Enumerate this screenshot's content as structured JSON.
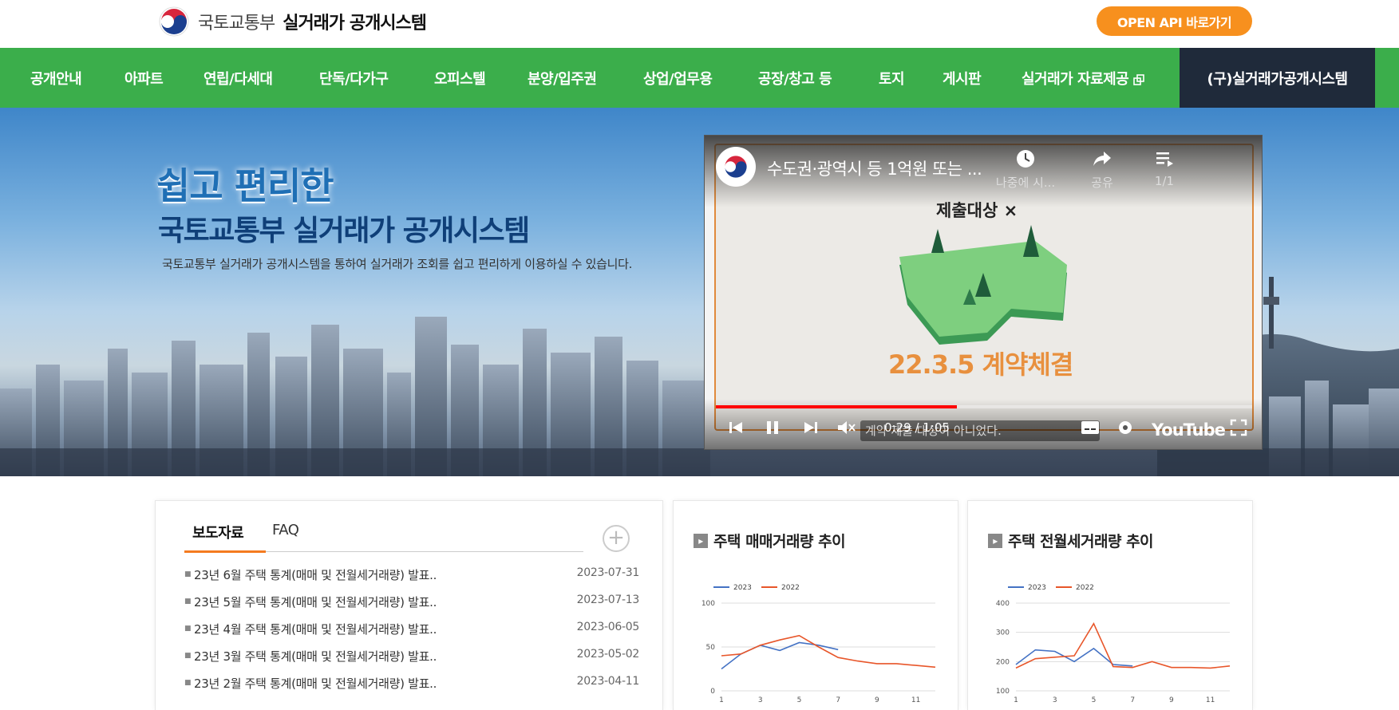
{
  "header": {
    "ministry": "국토교통부",
    "system_name": "실거래가 공개시스템",
    "open_api_label": "OPEN API 바로가기"
  },
  "nav": {
    "items": [
      {
        "label": "공개안내"
      },
      {
        "label": "아파트"
      },
      {
        "label": "연립/다세대"
      },
      {
        "label": "단독/다가구"
      },
      {
        "label": "오피스텔"
      },
      {
        "label": "분양/입주권"
      },
      {
        "label": "상업/업무용"
      },
      {
        "label": "공장/창고 등"
      },
      {
        "label": "토지"
      },
      {
        "label": "게시판"
      },
      {
        "label": "실거래가 자료제공"
      }
    ],
    "old_system_label": "(구)실거래가공개시스템"
  },
  "hero": {
    "title_line1": "쉽고 편리한",
    "title_line2": "국토교통부 실거래가 공개시스템",
    "description": "국토교통부 실거래가 공개시스템을 통하여 실거래가 조회를 쉽고 편리하게 이용하실 수 있습니다."
  },
  "video": {
    "channel_label": "국토교통부",
    "title": "수도권·광역시 등 1억원 또는 ...",
    "watch_later_label": "나중에 시...",
    "share_label": "공유",
    "playlist_label": "1/1",
    "caption_text": "제출대상 ×",
    "date_text": "22.3.5 계약체결",
    "time_display": "0:29 / 1:05",
    "subtitle_text": "계약 제출 대상이 아니었다.",
    "progress_fraction": 0.45,
    "youtube_label": "YouTube"
  },
  "news": {
    "tabs": [
      {
        "label": "보도자료"
      },
      {
        "label": "FAQ"
      }
    ],
    "more_label": "+",
    "items": [
      {
        "title": "23년 6월 주택 통계(매매 및 전월세거래량) 발표..",
        "date": "2023-07-31"
      },
      {
        "title": "23년 5월 주택 통계(매매 및 전월세거래량) 발표..",
        "date": "2023-07-13"
      },
      {
        "title": "23년 4월 주택 통계(매매 및 전월세거래량) 발표..",
        "date": "2023-06-05"
      },
      {
        "title": "23년 3월 주택 통계(매매 및 전월세거래량) 발표..",
        "date": "2023-05-02"
      },
      {
        "title": "23년 2월 주택 통계(매매 및 전월세거래량) 발표..",
        "date": "2023-04-11"
      }
    ]
  },
  "chart_data": [
    {
      "type": "line",
      "title": "주택 매매거래량 추이",
      "legend": "top-left",
      "grid": true,
      "x": [
        1,
        2,
        3,
        4,
        5,
        6,
        7,
        8,
        9,
        10,
        11,
        12
      ],
      "x_ticks": [
        "1",
        "3",
        "5",
        "7",
        "9",
        "11"
      ],
      "y_ticks": [
        "0",
        "50",
        "100"
      ],
      "ylim": [
        0,
        100
      ],
      "series": [
        {
          "name": "2023",
          "color": "#4472c4",
          "values": [
            25,
            42,
            52,
            46,
            55,
            52,
            47
          ]
        },
        {
          "name": "2022",
          "color": "#e8562a",
          "values": [
            40,
            42,
            52,
            58,
            63,
            50,
            38,
            34,
            31,
            31,
            29,
            27
          ]
        }
      ]
    },
    {
      "type": "line",
      "title": "주택 전월세거래량 추이",
      "legend": "top-left",
      "grid": true,
      "x": [
        1,
        2,
        3,
        4,
        5,
        6,
        7,
        8,
        9,
        10,
        11,
        12
      ],
      "x_ticks": [
        "1",
        "3",
        "5",
        "7",
        "9",
        "11"
      ],
      "y_ticks": [
        "100",
        "200",
        "300",
        "400"
      ],
      "ylim": [
        100,
        400
      ],
      "series": [
        {
          "name": "2023",
          "color": "#4472c4",
          "values": [
            190,
            240,
            235,
            200,
            245,
            190,
            185
          ]
        },
        {
          "name": "2022",
          "color": "#e8562a",
          "values": [
            178,
            210,
            215,
            220,
            330,
            183,
            180,
            200,
            180,
            180,
            178,
            185
          ]
        }
      ]
    }
  ]
}
